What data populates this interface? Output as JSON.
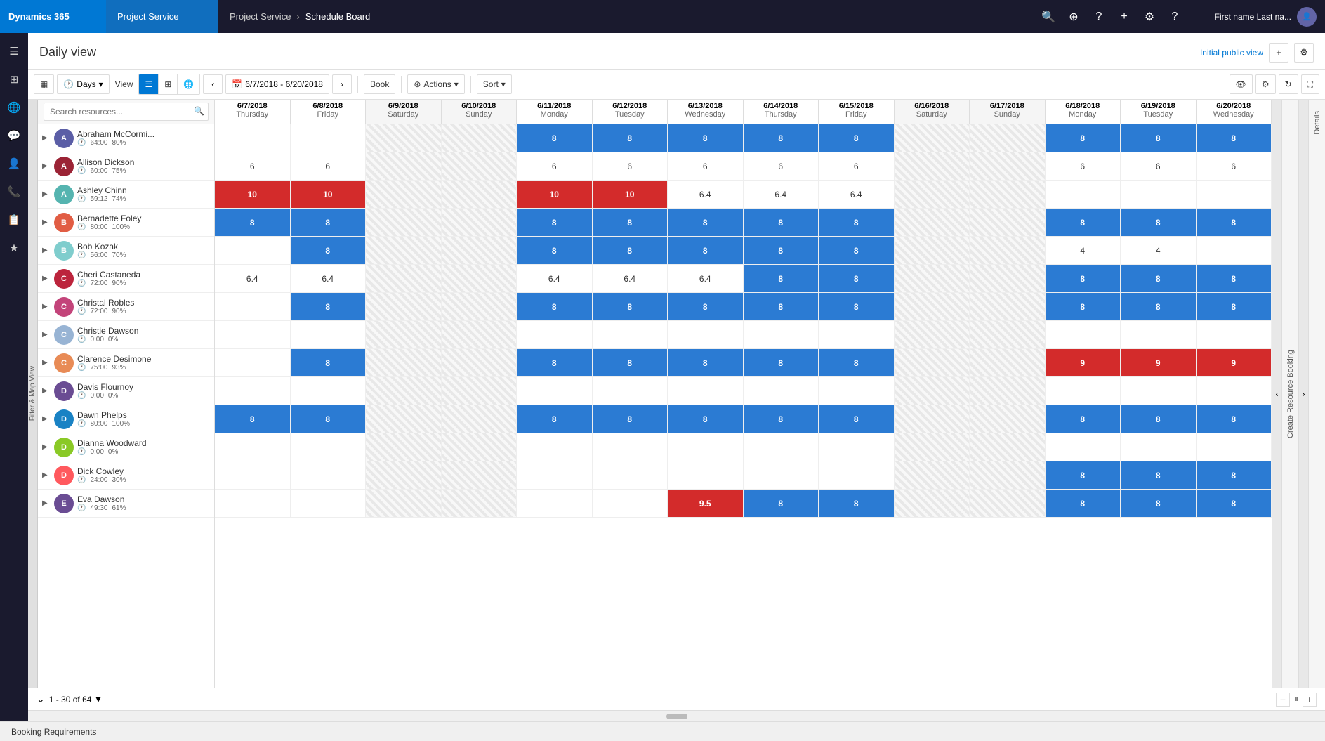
{
  "app": {
    "brand": "Dynamics 365",
    "module": "Project Service",
    "breadcrumb": [
      "Project Service",
      "Schedule Board"
    ],
    "user": "First name Last na...",
    "page_title": "Daily view",
    "initial_view_label": "Initial public view"
  },
  "toolbar": {
    "days_label": "Days",
    "view_label": "View",
    "date_range": "6/7/2018 - 6/20/2018",
    "book_label": "Book",
    "actions_label": "Actions",
    "sort_label": "Sort"
  },
  "search": {
    "placeholder": "Search resources..."
  },
  "dates": [
    {
      "date": "6/7/2018",
      "day": "Thursday",
      "weekend": false
    },
    {
      "date": "6/8/2018",
      "day": "Friday",
      "weekend": false
    },
    {
      "date": "6/9/2018",
      "day": "Saturday",
      "weekend": true
    },
    {
      "date": "6/10/2018",
      "day": "Sunday",
      "weekend": true
    },
    {
      "date": "6/11/2018",
      "day": "Monday",
      "weekend": false
    },
    {
      "date": "6/12/2018",
      "day": "Tuesday",
      "weekend": false
    },
    {
      "date": "6/13/2018",
      "day": "Wednesday",
      "weekend": false
    },
    {
      "date": "6/14/2018",
      "day": "Thursday",
      "weekend": false
    },
    {
      "date": "6/15/2018",
      "day": "Friday",
      "weekend": false
    },
    {
      "date": "6/16/2018",
      "day": "Saturday",
      "weekend": true
    },
    {
      "date": "6/17/2018",
      "day": "Sunday",
      "weekend": true
    },
    {
      "date": "6/18/2018",
      "day": "Monday",
      "weekend": false
    },
    {
      "date": "6/19/2018",
      "day": "Tuesday",
      "weekend": false
    },
    {
      "date": "6/20/2018",
      "day": "Wednesday",
      "weekend": false
    }
  ],
  "resources": [
    {
      "name": "Abraham McCormi...",
      "hours": "64:00",
      "pct": "80%",
      "expand": false,
      "cells": [
        "empty",
        "empty",
        "weekend",
        "weekend",
        "booked-8",
        "booked-8",
        "booked-8",
        "booked-8",
        "booked-8",
        "weekend",
        "weekend",
        "booked-8",
        "booked-8",
        "booked-8"
      ]
    },
    {
      "name": "Allison Dickson",
      "hours": "60:00",
      "pct": "75%",
      "expand": false,
      "cells": [
        "value-6",
        "value-6",
        "weekend",
        "weekend",
        "value-6",
        "value-6",
        "value-6",
        "value-6",
        "value-6",
        "weekend",
        "weekend",
        "value-6",
        "value-6",
        "value-6"
      ]
    },
    {
      "name": "Ashley Chinn",
      "hours": "59:12",
      "pct": "74%",
      "expand": false,
      "cells": [
        "over-10",
        "over-10",
        "weekend",
        "weekend",
        "over-10",
        "over-10",
        "value-6.4",
        "value-6.4",
        "value-6.4",
        "weekend",
        "weekend",
        "empty",
        "empty",
        "empty"
      ]
    },
    {
      "name": "Bernadette Foley",
      "hours": "80:00",
      "pct": "100%",
      "expand": false,
      "cells": [
        "booked-8",
        "booked-8",
        "weekend",
        "weekend",
        "booked-8",
        "booked-8",
        "booked-8",
        "booked-8",
        "booked-8",
        "weekend",
        "weekend",
        "booked-8",
        "booked-8",
        "booked-8"
      ]
    },
    {
      "name": "Bob Kozak",
      "hours": "56:00",
      "pct": "70%",
      "expand": false,
      "cells": [
        "empty",
        "booked-8",
        "weekend",
        "weekend",
        "booked-8",
        "booked-8",
        "booked-8",
        "booked-8",
        "booked-8",
        "weekend",
        "weekend",
        "value-4",
        "value-4",
        "empty"
      ]
    },
    {
      "name": "Cheri Castaneda",
      "hours": "72:00",
      "pct": "90%",
      "expand": false,
      "cells": [
        "value-6.4",
        "value-6.4",
        "weekend",
        "weekend",
        "value-6.4",
        "value-6.4",
        "value-6.4",
        "booked-8",
        "booked-8",
        "weekend",
        "weekend",
        "booked-8",
        "booked-8",
        "booked-8"
      ]
    },
    {
      "name": "Christal Robles",
      "hours": "72:00",
      "pct": "90%",
      "expand": true,
      "cells": [
        "empty",
        "booked-8",
        "weekend",
        "weekend",
        "booked-8",
        "booked-8",
        "booked-8",
        "booked-8",
        "booked-8",
        "weekend",
        "weekend",
        "booked-8",
        "booked-8",
        "booked-8"
      ]
    },
    {
      "name": "Christie Dawson",
      "hours": "0:00",
      "pct": "0%",
      "expand": false,
      "cells": [
        "empty",
        "empty",
        "weekend",
        "weekend",
        "empty",
        "empty",
        "empty",
        "empty",
        "empty",
        "weekend",
        "weekend",
        "empty",
        "empty",
        "empty"
      ]
    },
    {
      "name": "Clarence Desimone",
      "hours": "75:00",
      "pct": "93%",
      "expand": false,
      "cells": [
        "empty",
        "booked-8",
        "weekend",
        "weekend",
        "booked-8",
        "booked-8",
        "booked-8",
        "booked-8",
        "booked-8",
        "weekend",
        "weekend",
        "over-9",
        "over-9",
        "over-9"
      ]
    },
    {
      "name": "Davis Flournoy",
      "hours": "0:00",
      "pct": "0%",
      "expand": false,
      "cells": [
        "empty",
        "empty",
        "weekend",
        "weekend",
        "empty",
        "empty",
        "empty",
        "empty",
        "empty",
        "weekend",
        "weekend",
        "empty",
        "empty",
        "empty"
      ]
    },
    {
      "name": "Dawn Phelps",
      "hours": "80:00",
      "pct": "100%",
      "expand": false,
      "cells": [
        "booked-8",
        "booked-8",
        "weekend",
        "weekend",
        "booked-8",
        "booked-8",
        "booked-8",
        "booked-8",
        "booked-8",
        "weekend",
        "weekend",
        "booked-8",
        "booked-8",
        "booked-8"
      ]
    },
    {
      "name": "Dianna Woodward",
      "hours": "0:00",
      "pct": "0%",
      "expand": false,
      "cells": [
        "empty",
        "empty",
        "weekend",
        "weekend",
        "empty",
        "empty",
        "empty",
        "empty",
        "empty",
        "weekend",
        "weekend",
        "empty",
        "empty",
        "empty"
      ]
    },
    {
      "name": "Dick Cowley",
      "hours": "24:00",
      "pct": "30%",
      "expand": false,
      "cells": [
        "empty",
        "empty",
        "weekend",
        "weekend",
        "empty",
        "empty",
        "empty",
        "empty",
        "empty",
        "weekend",
        "weekend",
        "booked-8",
        "booked-8",
        "booked-8"
      ]
    },
    {
      "name": "Eva Dawson",
      "hours": "49:30",
      "pct": "61%",
      "expand": false,
      "cells": [
        "empty",
        "empty",
        "weekend",
        "weekend",
        "empty",
        "empty",
        "over-9.5",
        "booked-8",
        "booked-8",
        "weekend",
        "weekend",
        "booked-8",
        "booked-8",
        "booked-8"
      ]
    }
  ],
  "pagination": {
    "text": "1 - 30 of 64"
  },
  "bottom_bar": {
    "label": "Booking Requirements"
  },
  "sidebar_icons": [
    "☰",
    "📊",
    "🌐",
    "💬",
    "👤",
    "📞",
    "📋",
    "⭐"
  ],
  "right_panels": [
    "Details",
    "Create Resource Booking"
  ]
}
